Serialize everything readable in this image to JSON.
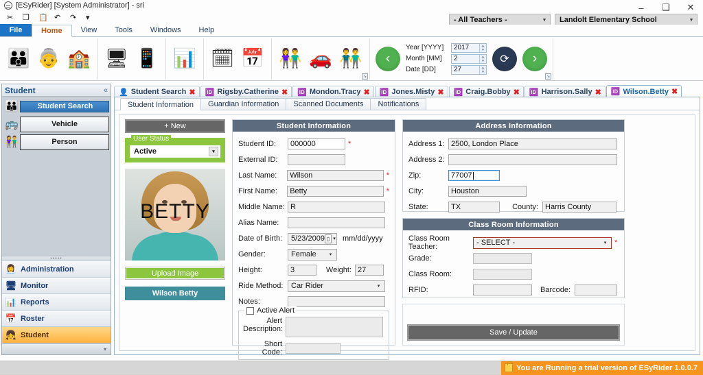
{
  "window": {
    "title": "[ESyRider] [System Administrator] - sri",
    "app_icon": "app-logo-icon",
    "minimize": "–",
    "maximize": "❑",
    "close": "✕"
  },
  "quick_access": [
    {
      "name": "cut-icon",
      "glyph": "✂"
    },
    {
      "name": "copy-icon",
      "glyph": "❐"
    },
    {
      "name": "paste-icon",
      "glyph": "📋"
    },
    {
      "name": "undo-icon",
      "glyph": "↶"
    },
    {
      "name": "redo-icon",
      "glyph": "↷"
    },
    {
      "name": "customize-icon",
      "glyph": "▾"
    }
  ],
  "top_combos": {
    "teachers": "- All Teachers -",
    "school": "Landolt Elementary School",
    "arrow": "▾"
  },
  "menu": {
    "file": "File",
    "tabs": [
      {
        "label": "Home",
        "active": true
      },
      {
        "label": "View",
        "active": false
      },
      {
        "label": "Tools",
        "active": false
      },
      {
        "label": "Windows",
        "active": false
      },
      {
        "label": "Help",
        "active": false
      }
    ]
  },
  "ribbon": {
    "groups": [
      {
        "name": "people-group",
        "buttons": [
          {
            "name": "students-icon",
            "glyph": "👪"
          },
          {
            "name": "staff-icon",
            "glyph": "👵"
          },
          {
            "name": "school-icon",
            "glyph": "🏫"
          }
        ]
      },
      {
        "name": "monitor-group",
        "buttons": [
          {
            "name": "monitor-icon",
            "glyph": "🖥"
          },
          {
            "name": "touchscreen-icon",
            "glyph": "📱"
          }
        ]
      },
      {
        "name": "reports-group",
        "buttons": [
          {
            "name": "reports-icon",
            "glyph": "📊"
          }
        ]
      },
      {
        "name": "calendar-group",
        "buttons": [
          {
            "name": "calendar-icon",
            "glyph": "🗓"
          },
          {
            "name": "date-19-icon",
            "glyph": "📅"
          }
        ]
      },
      {
        "name": "roster-group",
        "buttons": [
          {
            "name": "family-icon",
            "glyph": "👫"
          },
          {
            "name": "vehicle-icon",
            "glyph": "🚗"
          },
          {
            "name": "guardians-icon",
            "glyph": "👬"
          }
        ]
      }
    ],
    "dialog_launcher": "↘",
    "nav": {
      "prev": "‹",
      "next": "›",
      "refresh": "⟳",
      "fields": [
        {
          "label": "Year [YYYY]",
          "value": "2017"
        },
        {
          "label": "Month [MM]",
          "value": "2"
        },
        {
          "label": "Date [DD]",
          "value": "27"
        }
      ],
      "spin_up": "▴",
      "spin_down": "▾"
    }
  },
  "sidebar": {
    "header": "Student",
    "collapse": "«",
    "items": [
      {
        "label": "Student Search",
        "icon": "students-icon",
        "glyph": "👪",
        "selected": true
      },
      {
        "label": "Vehicle",
        "icon": "vehicle-icon",
        "glyph": "🚌",
        "selected": false
      },
      {
        "label": "Person",
        "icon": "person-icon",
        "glyph": "👫",
        "selected": false
      }
    ],
    "grip": "•••••",
    "nav": [
      {
        "label": "Administration",
        "icon": "administration-icon",
        "glyph": "👩‍💼",
        "active": false
      },
      {
        "label": "Monitor",
        "icon": "monitor-icon",
        "glyph": "🖥",
        "active": false
      },
      {
        "label": "Reports",
        "icon": "reports-icon",
        "glyph": "📊",
        "active": false
      },
      {
        "label": "Roster",
        "icon": "roster-icon",
        "glyph": "📅",
        "active": false
      },
      {
        "label": "Student",
        "icon": "student-icon",
        "glyph": "👧",
        "active": true
      }
    ],
    "footer_arrow": "▾"
  },
  "doc_tabs": [
    {
      "label": "Student Search",
      "icon": "search-person-icon",
      "glyph": "👤",
      "active": false,
      "close": "✖"
    },
    {
      "label": "Rigsby.Catherine",
      "icon": "student-card-icon",
      "glyph": "🆔",
      "active": false,
      "close": "✖"
    },
    {
      "label": "Mondon.Tracy",
      "icon": "student-card-icon",
      "glyph": "🆔",
      "active": false,
      "close": "✖"
    },
    {
      "label": "Jones.Misty",
      "icon": "student-card-icon",
      "glyph": "🆔",
      "active": false,
      "close": "✖"
    },
    {
      "label": "Craig.Bobby",
      "icon": "student-card-icon",
      "glyph": "🆔",
      "active": false,
      "close": "✖"
    },
    {
      "label": "Harrison.Sally",
      "icon": "student-card-icon",
      "glyph": "🆔",
      "active": false,
      "close": "✖"
    },
    {
      "label": "Wilson.Betty",
      "icon": "student-card-icon",
      "glyph": "🆔",
      "active": true,
      "close": "✖"
    }
  ],
  "sub_tabs": [
    {
      "label": "Student Information",
      "active": true
    },
    {
      "label": "Guardian Information",
      "active": false
    },
    {
      "label": "Scanned Documents",
      "active": false
    },
    {
      "label": "Notifications",
      "active": false
    }
  ],
  "photo_panel": {
    "new_button": "+ New",
    "user_status_legend": "User Status",
    "user_status_value": "Active",
    "dropdown_arrow": "▾",
    "photo_caption": "BETTY",
    "upload_button": "Upload Image",
    "name_button": "Wilson Betty"
  },
  "student_information": {
    "title": "Student Information",
    "fields": {
      "student_id": {
        "label": "Student ID:",
        "value": "000000",
        "required": true
      },
      "external_id": {
        "label": "External ID:",
        "value": "",
        "required": false
      },
      "last_name": {
        "label": "Last Name:",
        "value": "Wilson",
        "required": true
      },
      "first_name": {
        "label": "First Name:",
        "value": "Betty",
        "required": true
      },
      "middle_name": {
        "label": "Middle Name:",
        "value": "R",
        "required": false
      },
      "alias_name": {
        "label": "Alias Name:",
        "value": "",
        "required": false
      },
      "date_of_birth": {
        "label": "Date of Birth:",
        "value": "5/23/2009",
        "hint": "mm/dd/yyyy"
      },
      "gender": {
        "label": "Gender:",
        "value": "Female"
      },
      "height": {
        "label": "Height:",
        "value": "3"
      },
      "weight": {
        "label": "Weight:",
        "value": "27"
      },
      "ride_method": {
        "label": "Ride Method:",
        "value": "Car Rider"
      },
      "notes": {
        "label": "Notes:",
        "value": ""
      },
      "active_alert": {
        "label": "Active Alert",
        "checked": false
      },
      "alert_description": {
        "label": "Alert Description:",
        "value": ""
      },
      "short_code": {
        "label": "Short Code:",
        "value": ""
      }
    },
    "calendar_icon": "📅"
  },
  "address_information": {
    "title": "Address Information",
    "fields": {
      "address1": {
        "label": "Address 1:",
        "value": "2500, London Place"
      },
      "address2": {
        "label": "Address 2:",
        "value": ""
      },
      "zip": {
        "label": "Zip:",
        "value": "77007",
        "focused": true
      },
      "city": {
        "label": "City:",
        "value": "Houston"
      },
      "state": {
        "label": "State:",
        "value": "TX"
      },
      "county": {
        "label": "County:",
        "value": "Harris County"
      }
    }
  },
  "class_room_information": {
    "title": "Class Room Information",
    "fields": {
      "teacher": {
        "label": "Class Room Teacher:",
        "value": "- SELECT -",
        "required": true
      },
      "grade": {
        "label": "Grade:",
        "value": ""
      },
      "class_room": {
        "label": "Class Room:",
        "value": ""
      },
      "rfid": {
        "label": "RFID:",
        "value": ""
      },
      "barcode": {
        "label": "Barcode:",
        "value": ""
      }
    },
    "save_button": "Save / Update"
  },
  "status_bar": {
    "trial_message": "You are Running a trial version of ESyRider 1.0.0.7",
    "lock_icon": "lock-icon"
  },
  "colors": {
    "accent_blue": "#1b74c6",
    "panel_header": "#5d6b7e",
    "green": "#8cc63e",
    "teal": "#3f8e9b",
    "orange": "#f7941d",
    "required_red": "#e02020"
  }
}
